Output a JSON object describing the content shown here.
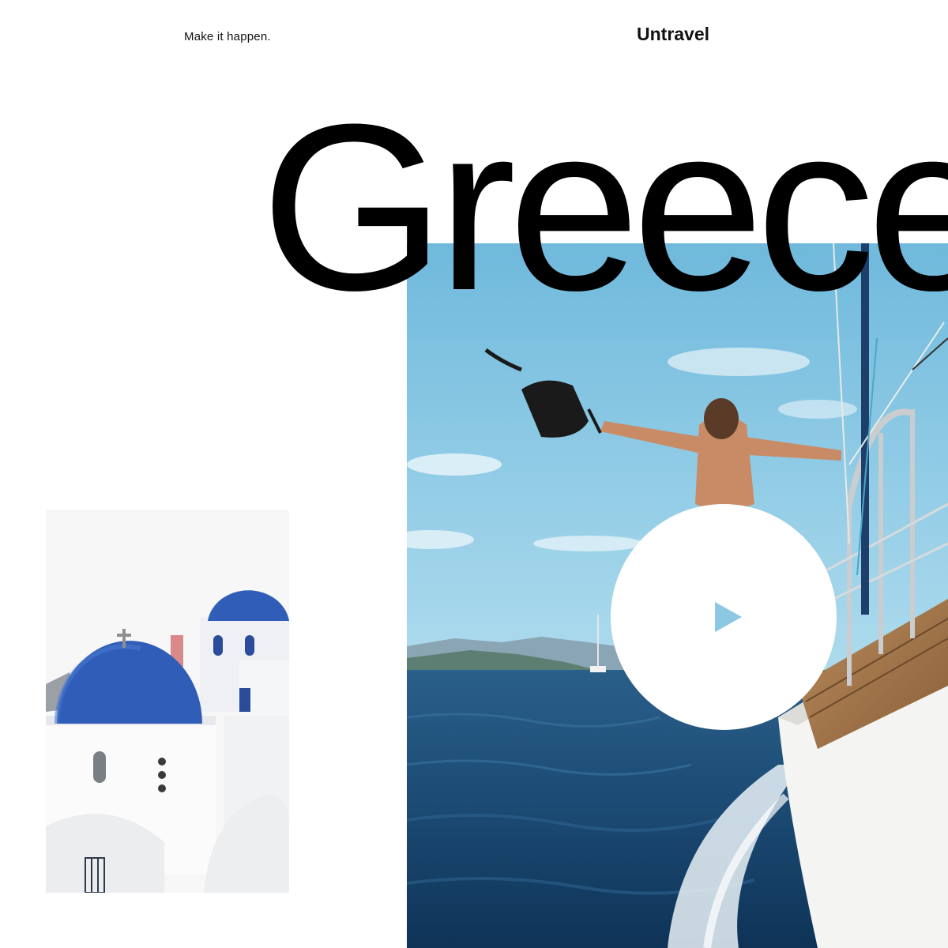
{
  "header": {
    "tagline": "Make it happen.",
    "brand": "Untravel"
  },
  "hero": {
    "headline": "Greece",
    "play_icon": "play-icon"
  },
  "colors": {
    "accent": "#8cc8e2",
    "sky": "#7cc2e0",
    "sea": "#1b4a73",
    "dome": "#2f5db7",
    "text": "#000000"
  }
}
